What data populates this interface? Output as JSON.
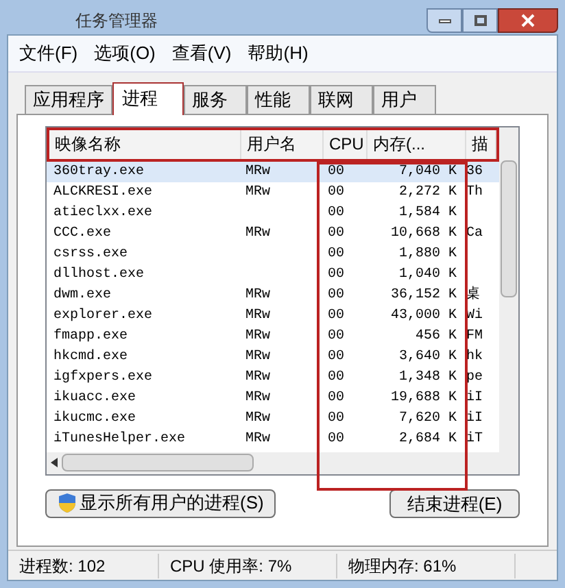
{
  "window": {
    "title": "任务管理器"
  },
  "menu": [
    "文件(F)",
    "选项(O)",
    "查看(V)",
    "帮助(H)"
  ],
  "tabs": [
    {
      "label": "应用程序",
      "selected": false
    },
    {
      "label": "进程",
      "selected": true
    },
    {
      "label": "服务",
      "selected": false
    },
    {
      "label": "性能",
      "selected": false
    },
    {
      "label": "联网",
      "selected": false
    },
    {
      "label": "用户",
      "selected": false
    }
  ],
  "table": {
    "columns": [
      "映像名称",
      "用户名",
      "CPU",
      "内存(...",
      "描"
    ],
    "rows": [
      {
        "cells": [
          "360tray.exe",
          "MRw",
          "00",
          "7,040 K",
          "36"
        ],
        "selected": true
      },
      {
        "cells": [
          "ALCKRESI.exe",
          "MRw",
          "00",
          "2,272 K",
          "Th"
        ],
        "selected": false
      },
      {
        "cells": [
          "atieclxx.exe",
          "",
          "00",
          "1,584 K",
          ""
        ],
        "selected": false
      },
      {
        "cells": [
          "CCC.exe",
          "MRw",
          "00",
          "10,668 K",
          "Ca"
        ],
        "selected": false
      },
      {
        "cells": [
          "csrss.exe",
          "",
          "00",
          "1,880 K",
          ""
        ],
        "selected": false
      },
      {
        "cells": [
          "dllhost.exe",
          "",
          "00",
          "1,040 K",
          ""
        ],
        "selected": false
      },
      {
        "cells": [
          "dwm.exe",
          "MRw",
          "00",
          "36,152 K",
          "桌"
        ],
        "selected": false
      },
      {
        "cells": [
          "explorer.exe",
          "MRw",
          "00",
          "43,000 K",
          "Wi"
        ],
        "selected": false
      },
      {
        "cells": [
          "fmapp.exe",
          "MRw",
          "00",
          "456 K",
          "FM"
        ],
        "selected": false
      },
      {
        "cells": [
          "hkcmd.exe",
          "MRw",
          "00",
          "3,640 K",
          "hk"
        ],
        "selected": false
      },
      {
        "cells": [
          "igfxpers.exe",
          "MRw",
          "00",
          "1,348 K",
          "pe"
        ],
        "selected": false
      },
      {
        "cells": [
          "ikuacc.exe",
          "MRw",
          "00",
          "19,688 K",
          "iI"
        ],
        "selected": false
      },
      {
        "cells": [
          "ikucmc.exe",
          "MRw",
          "00",
          "7,620 K",
          "iI"
        ],
        "selected": false
      },
      {
        "cells": [
          "iTunesHelper.exe",
          "MRw",
          "00",
          "2,684 K",
          "iT"
        ],
        "selected": false
      }
    ]
  },
  "buttons": {
    "show_all": "显示所有用户的进程(S)",
    "end": "结束进程(E)"
  },
  "status_bar": [
    "进程数: 102",
    "CPU 使用率: 7%",
    "物理内存: 61%"
  ]
}
